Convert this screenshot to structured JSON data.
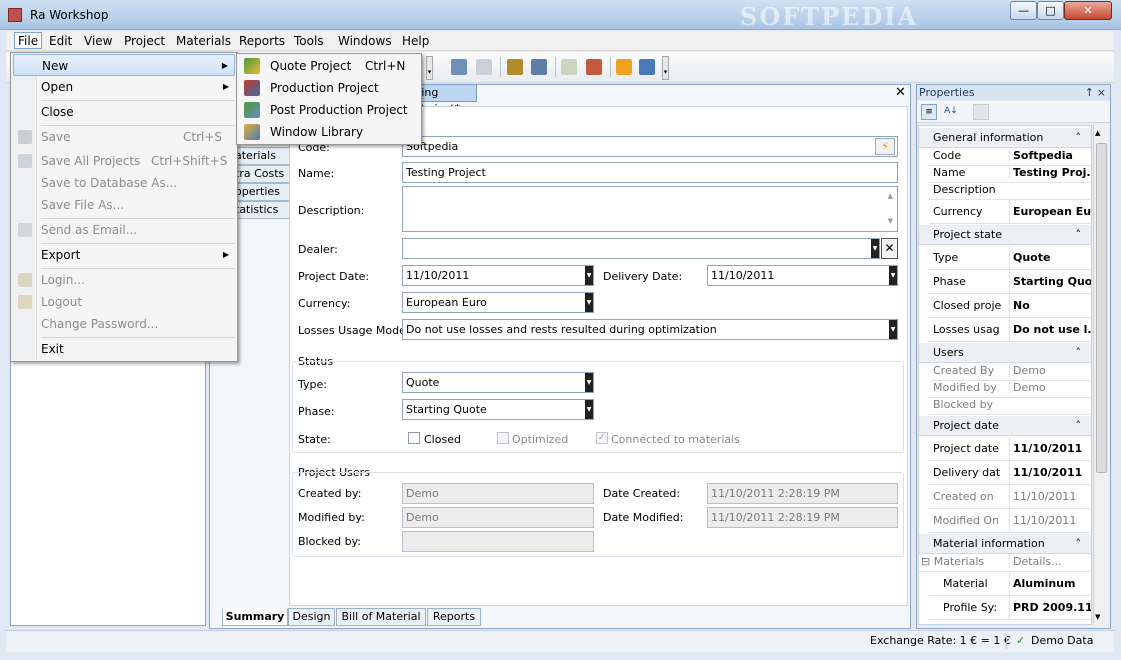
{
  "window": {
    "title": "Ra Workshop",
    "watermark": "SOFTPEDIA"
  },
  "menubar": [
    "File",
    "Edit",
    "View",
    "Project",
    "Materials",
    "Reports",
    "Tools",
    "Windows",
    "Help"
  ],
  "file_menu": {
    "new": "New",
    "open": "Open",
    "close": "Close",
    "save": "Save",
    "save_sc": "Ctrl+S",
    "save_all": "Save All Projects",
    "save_all_sc": "Ctrl+Shift+S",
    "save_db": "Save to Database As...",
    "save_file": "Save File As...",
    "send_email": "Send as Email...",
    "export": "Export",
    "login": "Login...",
    "logout": "Logout",
    "change_password": "Change Password...",
    "exit": "Exit"
  },
  "new_menu": {
    "quote": "Quote Project",
    "quote_sc": "Ctrl+N",
    "production": "Production Project",
    "post_production": "Post Production Project",
    "window_library": "Window Library"
  },
  "document": {
    "tab": "ting Project*",
    "side_tabs": [
      "aterials",
      "tra Costs",
      "operties",
      "tatistics"
    ]
  },
  "form": {
    "code_label": "Code:",
    "code": "Softpedia",
    "name_label": "Name:",
    "name": "Testing Project",
    "description_label": "Description:",
    "description": "",
    "dealer_label": "Dealer:",
    "dealer": "",
    "project_date_label": "Project Date:",
    "project_date": "11/10/2011",
    "delivery_date_label": "Delivery Date:",
    "delivery_date": "11/10/2011",
    "currency_label": "Currency:",
    "currency": "European Euro",
    "losses_label": "Losses Usage Mode:",
    "losses": "Do not use losses and rests resulted during optimization",
    "status_group": "Status",
    "type_label": "Type:",
    "type": "Quote",
    "phase_label": "Phase:",
    "phase": "Starting Quote",
    "state_label": "State:",
    "closed": "Closed",
    "optimized": "Optimized",
    "connected": "Connected to materials",
    "users_group": "Project Users",
    "created_by_label": "Created by:",
    "created_by": "Demo",
    "modified_by_label": "Modified by:",
    "modified_by": "Demo",
    "blocked_by_label": "Blocked by:",
    "blocked_by": "",
    "date_created_label": "Date Created:",
    "date_created": "11/10/2011 2:28:19 PM",
    "date_modified_label": "Date Modified:",
    "date_modified": "11/10/2011 2:28:19 PM"
  },
  "bottom_tabs": [
    "Summary",
    "Design",
    "Bill of Material",
    "Reports"
  ],
  "properties": {
    "title": "Properties",
    "pin": "↑",
    "close": "×",
    "general": "General information",
    "code_k": "Code",
    "code_v": "Softpedia",
    "name_k": "Name",
    "name_v": "Testing Proj...",
    "desc_k": "Description",
    "desc_v": "",
    "currency_k": "Currency",
    "currency_v": "European Euro",
    "state": "Project state",
    "type_k": "Type",
    "type_v": "Quote",
    "phase_k": "Phase",
    "phase_v": "Starting Quo...",
    "closed_k": "Closed proje",
    "closed_v": "No",
    "losses_k": "Losses usag",
    "losses_v": "Do not use l...",
    "users": "Users",
    "created_k": "Created By",
    "created_v": "Demo",
    "modified_k": "Modified by",
    "modified_v": "Demo",
    "blocked_k": "Blocked by",
    "blocked_v": "",
    "date": "Project date",
    "pdate_k": "Project date",
    "pdate_v": "11/10/2011",
    "ddate_k": "Delivery dat",
    "ddate_v": "11/10/2011",
    "con_k": "Created on",
    "con_v": "11/10/2011",
    "mon_k": "Modified On",
    "mon_v": "11/10/2011",
    "material": "Material information",
    "materials_k": "Materials",
    "materials_v": "Details...",
    "mat_k": "Material",
    "mat_v": "Aluminum",
    "prof_k": "Profile Sy:",
    "prof_v": "PRD 2009.11"
  },
  "status": {
    "exchange": "Exchange Rate: 1 € = 1 €",
    "demo": "Demo Data"
  }
}
